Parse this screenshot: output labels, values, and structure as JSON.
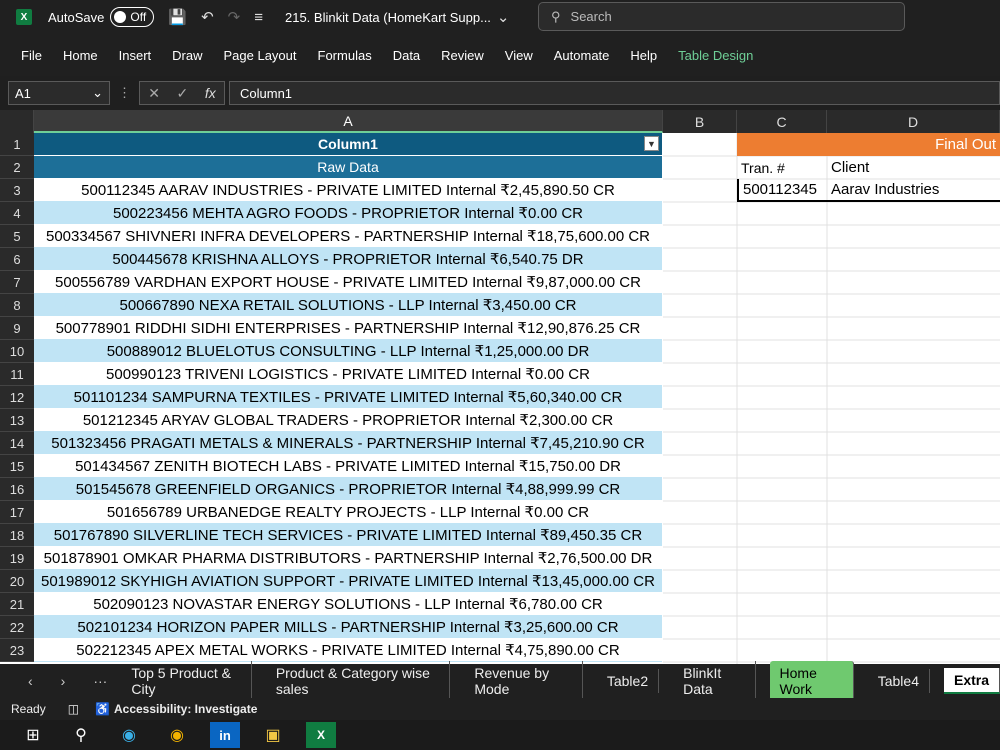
{
  "titlebar": {
    "app_logo": "X",
    "autosave_label": "AutoSave",
    "autosave_state": "Off",
    "doc_title": "215. Blinkit Data (HomeKart Supp...",
    "search_placeholder": "Search"
  },
  "menu": [
    "File",
    "Home",
    "Insert",
    "Draw",
    "Page Layout",
    "Formulas",
    "Data",
    "Review",
    "View",
    "Automate",
    "Help",
    "Table Design"
  ],
  "formula_bar": {
    "name_box": "A1",
    "content": "Column1"
  },
  "columns": [
    "A",
    "B",
    "C",
    "D"
  ],
  "table": {
    "header": "Column1",
    "raw_label": "Raw Data",
    "rows": [
      "500112345 AARAV INDUSTRIES - PRIVATE LIMITED  Internal ₹2,45,890.50 CR",
      "500223456 MEHTA AGRO FOODS - PROPRIETOR  Internal ₹0.00 CR",
      "500334567 SHIVNERI INFRA DEVELOPERS - PARTNERSHIP  Internal ₹18,75,600.00 CR",
      "500445678 KRISHNA ALLOYS - PROPRIETOR  Internal ₹6,540.75 DR",
      "500556789 VARDHAN EXPORT HOUSE - PRIVATE LIMITED  Internal ₹9,87,000.00 CR",
      "500667890 NEXA RETAIL SOLUTIONS - LLP  Internal ₹3,450.00 CR",
      "500778901 RIDDHI SIDHI ENTERPRISES - PARTNERSHIP  Internal ₹12,90,876.25 CR",
      "500889012 BLUELOTUS CONSULTING - LLP  Internal ₹1,25,000.00 DR",
      "500990123 TRIVENI LOGISTICS - PRIVATE LIMITED  Internal ₹0.00 CR",
      "501101234 SAMPURNA TEXTILES - PRIVATE LIMITED  Internal ₹5,60,340.00 CR",
      "501212345 ARYAV GLOBAL TRADERS - PROPRIETOR  Internal ₹2,300.00 CR",
      "501323456 PRAGATI METALS & MINERALS - PARTNERSHIP  Internal ₹7,45,210.90 CR",
      "501434567 ZENITH BIOTECH LABS - PRIVATE LIMITED  Internal ₹15,750.00 DR",
      "501545678 GREENFIELD ORGANICS - PROPRIETOR  Internal ₹4,88,999.99 CR",
      "501656789 URBANEDGE REALTY PROJECTS - LLP  Internal ₹0.00 CR",
      "501767890 SILVERLINE TECH SERVICES - PRIVATE LIMITED  Internal ₹89,450.35 CR",
      "501878901 OMKAR PHARMA DISTRIBUTORS - PARTNERSHIP  Internal ₹2,76,500.00 DR",
      "501989012 SKYHIGH AVIATION SUPPORT - PRIVATE LIMITED  Internal ₹13,45,000.00 CR",
      "502090123 NOVASTAR ENERGY SOLUTIONS - LLP  Internal ₹6,780.00 CR",
      "502101234 HORIZON PAPER MILLS - PARTNERSHIP  Internal ₹3,25,600.00 CR",
      "502212345 APEX METAL WORKS - PRIVATE LIMITED  Internal ₹4,75,890.00 CR"
    ]
  },
  "output": {
    "title": "Final Out",
    "col_c_header": "Tran. #",
    "col_d_header": "Client",
    "tran": "500112345",
    "client": "Aarav Industries"
  },
  "row_numbers": [
    "1",
    "2",
    "3",
    "4",
    "5",
    "6",
    "7",
    "8",
    "9",
    "10",
    "11",
    "12",
    "13",
    "14",
    "15",
    "16",
    "17",
    "18",
    "19",
    "20",
    "21",
    "22",
    "23"
  ],
  "sheets": {
    "nav_more": "···",
    "tabs": [
      "Top 5 Product & City",
      "Product & Category wise sales",
      "Revenue by Mode",
      "Table2",
      "BlinkIt Data",
      "Home Work",
      "Table4",
      "Extra"
    ],
    "active": "Home Work"
  },
  "status": {
    "ready": "Ready",
    "accessibility": "Accessibility: Investigate"
  },
  "colors": {
    "header_blue": "#0e5a80",
    "band_blue": "#c0e4f5",
    "output_orange": "#ed7d31",
    "excel_green": "#107c41"
  }
}
